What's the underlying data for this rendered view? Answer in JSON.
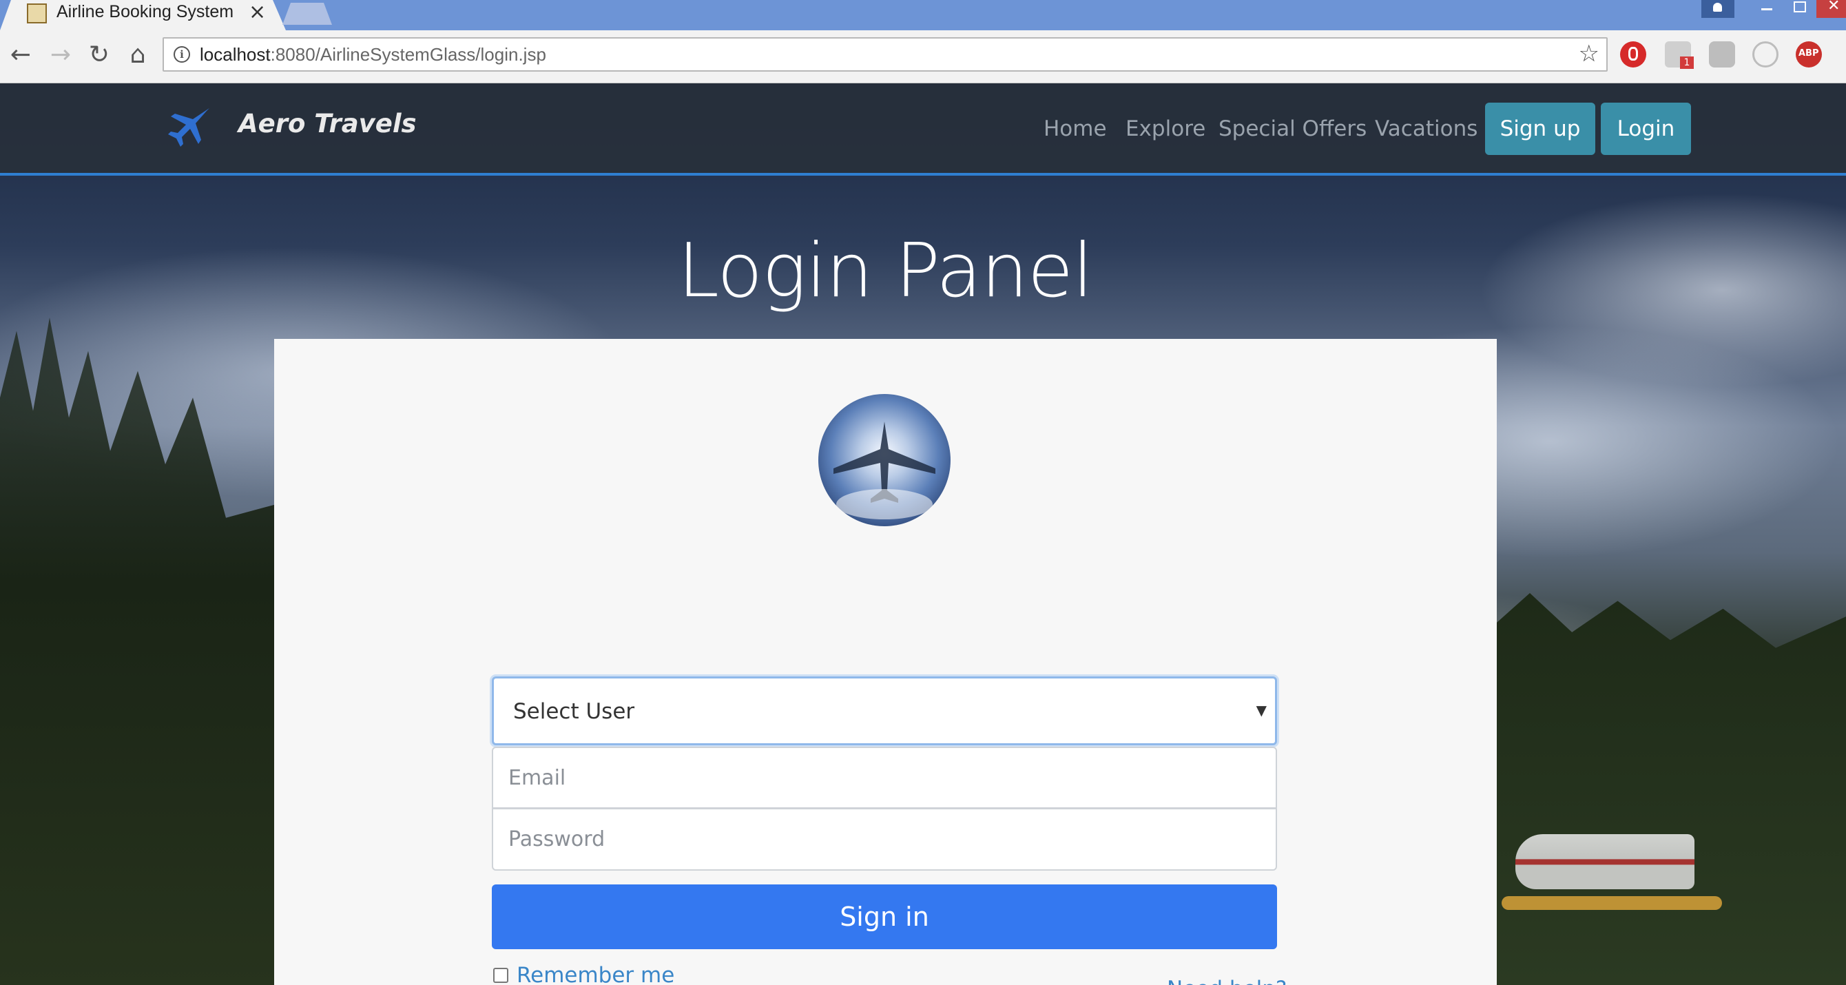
{
  "browser": {
    "tab_title": "Airline Booking System",
    "tab_close": "×",
    "url_host": "localhost",
    "url_rest": ":8080/AirlineSystemGlass/login.jsp",
    "info_icon": "i",
    "extension_badge": "1",
    "abp_label": "ABP",
    "icons": {
      "back": "←",
      "forward": "→",
      "reload": "↻",
      "home": "⌂",
      "star": "☆"
    }
  },
  "navbar": {
    "brand": "Aero Travels",
    "links": [
      "Home",
      "Explore",
      "Special Offers",
      "Vacations"
    ],
    "signup": "Sign up",
    "login": "Login",
    "accent_color": "#2f7fd1",
    "button_color": "#3a8fa8"
  },
  "login": {
    "title": "Login Panel",
    "select_user": "Select User",
    "email_placeholder": "Email",
    "password_placeholder": "Password",
    "signin": "Sign in",
    "remember": "Remember me",
    "remember_checked": false,
    "help": "Need help?",
    "primary_color": "#3478f0",
    "link_color": "#3a86c8"
  }
}
